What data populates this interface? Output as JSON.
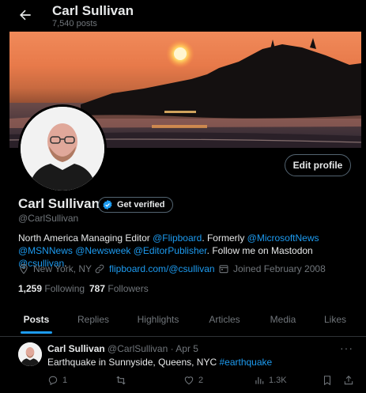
{
  "header": {
    "name": "Carl Sullivan",
    "post_count": "7,540 posts"
  },
  "profile": {
    "name": "Carl Sullivan",
    "handle": "@CarlSullivan",
    "verify_label": "Get verified",
    "edit_label": "Edit profile",
    "bio": {
      "t1": "North America Managing Editor ",
      "m1": "@Flipboard",
      "t2": ". Formerly ",
      "m2": "@MicrosoftNews",
      "m3": "@MSNNews",
      "t3": " ",
      "m4": "@Newsweek",
      "t4": " ",
      "m5": "@EditorPublisher",
      "t5": ". Follow me on Mastodon ",
      "m6": "@csullivan",
      "t6": "."
    },
    "location": "New York, NY",
    "website": "flipboard.com/@csullivan",
    "joined": "Joined February 2008",
    "following_count": "1,259",
    "following_label": "Following",
    "followers_count": "787",
    "followers_label": "Followers"
  },
  "tabs": [
    "Posts",
    "Replies",
    "Highlights",
    "Articles",
    "Media",
    "Likes"
  ],
  "tweet": {
    "name": "Carl Sullivan",
    "handle": "@CarlSullivan",
    "sep": "·",
    "date": "Apr 5",
    "text": "Earthquake in Sunnyside, Queens, NYC ",
    "hashtag": "#earthquake",
    "replies": "1",
    "likes": "2",
    "views": "1.3K"
  },
  "colors": {
    "accent": "#1d9bf0",
    "background": "#000000",
    "muted": "#71767b",
    "text": "#e7e9ea"
  }
}
